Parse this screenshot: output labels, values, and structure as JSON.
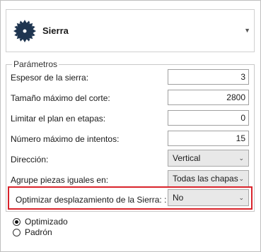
{
  "header": {
    "icon": "saw-blade-icon",
    "title": "Sierra",
    "dropdown_icon": "chevron-down-icon"
  },
  "params": {
    "legend": "Parámetros",
    "thickness": {
      "label": "Espesor de la sierra:",
      "value": "3"
    },
    "max_cut": {
      "label": "Tamaño máximo del corte:",
      "value": "2800"
    },
    "limit_stages": {
      "label": "Limitar el plan en etapas:",
      "value": "0"
    },
    "max_attempts": {
      "label": "Número máximo de intentos:",
      "value": "15"
    },
    "direction": {
      "label": "Dirección:",
      "value": "Vertical"
    },
    "group_pieces": {
      "label": "Agrupe piezas iguales en:",
      "value": "Todas las chapas"
    },
    "optimize_saw": {
      "label": "Optimizar desplazamiento de la Sierra: :",
      "value": "No"
    }
  },
  "mode": {
    "options": [
      {
        "label": "Optimizado",
        "checked": true
      },
      {
        "label": "Padrón",
        "checked": false
      }
    ]
  },
  "colors": {
    "highlight": "#d9232b",
    "saw_icon": "#1f3550"
  }
}
